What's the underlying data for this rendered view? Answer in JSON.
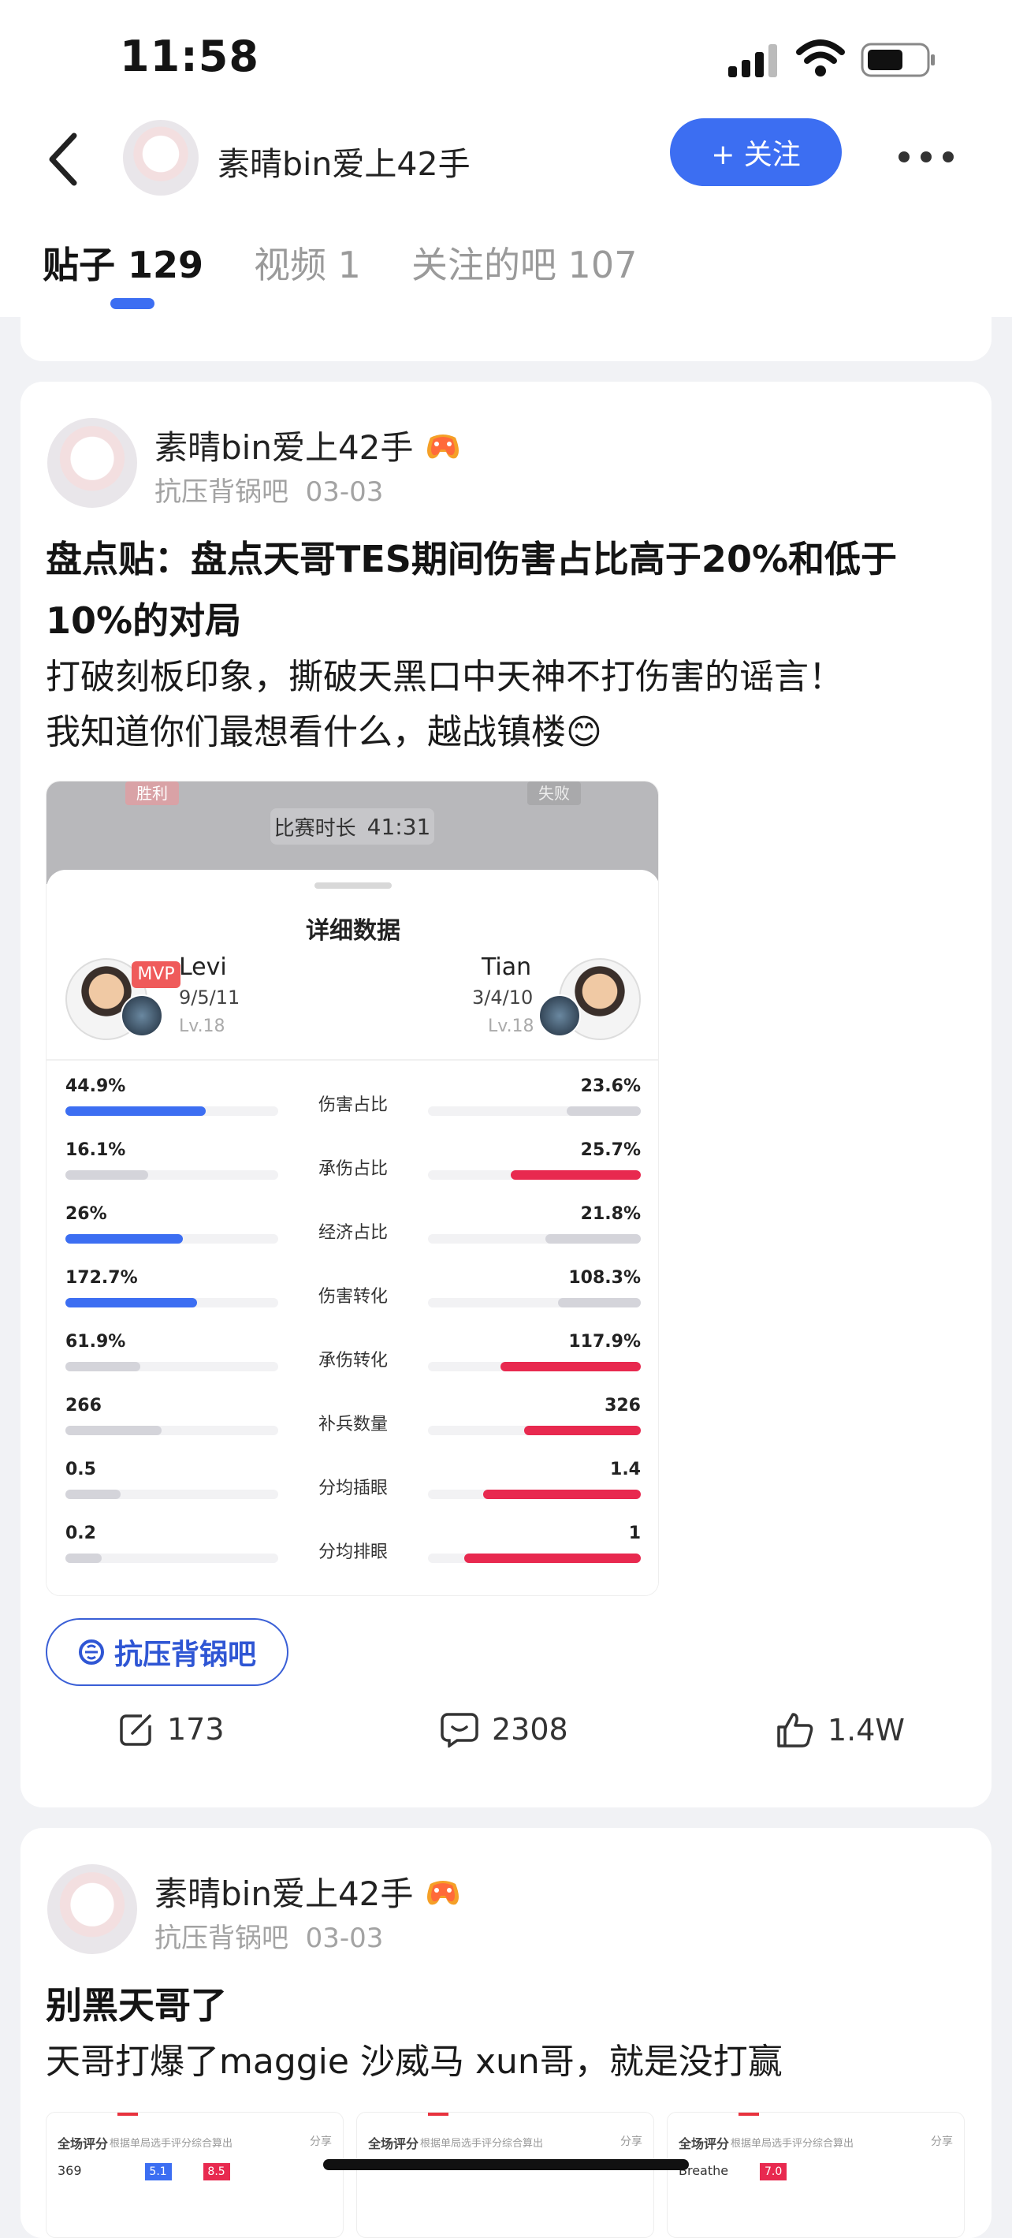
{
  "status_bar": {
    "time": "11:58"
  },
  "header": {
    "username": "素晴bin爱上42手",
    "follow_label": "+ 关注",
    "tabs": [
      {
        "label": "贴子 129"
      },
      {
        "label": "视频 1"
      },
      {
        "label": "关注的吧 107"
      }
    ]
  },
  "posts": [
    {
      "author": "素晴bin爱上42手",
      "forum": "抗压背锅吧",
      "date": "03-03",
      "title": "盘点贴：盘点天哥TES期间伤害占比高于20%和低于10%的对局",
      "body_lines": [
        "打破刻板印象，撕破天黑口中天神不打伤害的谣言！",
        "我知道你们最想看什么，越战镇楼😊"
      ],
      "forum_chip": "抗压背锅吧",
      "counts": {
        "share": "173",
        "comments": "2308",
        "likes": "1.4W"
      },
      "screenshot": {
        "win_label": "胜利",
        "lose_label": "失败",
        "duration_label": "比赛时长",
        "duration": "41:31",
        "sheet_title": "详细数据",
        "left_player": {
          "name": "Levi",
          "kda": "9/5/11",
          "level": "Lv.18",
          "mvp": "MVP"
        },
        "right_player": {
          "name": "Tian",
          "kda": "3/4/10",
          "level": "Lv.18"
        },
        "stats": [
          {
            "label": "伤害占比",
            "left": "44.9%",
            "right": "23.6%",
            "lfill": 0.66,
            "rfill": 0.35,
            "lcolor": "#3c6ef2",
            "rcolor": "#d4d4da"
          },
          {
            "label": "承伤占比",
            "left": "16.1%",
            "right": "25.7%",
            "lfill": 0.39,
            "rfill": 0.61,
            "lcolor": "#d4d4da",
            "rcolor": "#e8294f"
          },
          {
            "label": "经济占比",
            "left": "26%",
            "right": "21.8%",
            "lfill": 0.55,
            "rfill": 0.45,
            "lcolor": "#3c6ef2",
            "rcolor": "#d4d4da"
          },
          {
            "label": "伤害转化",
            "left": "172.7%",
            "right": "108.3%",
            "lfill": 0.62,
            "rfill": 0.39,
            "lcolor": "#3c6ef2",
            "rcolor": "#d4d4da"
          },
          {
            "label": "承伤转化",
            "left": "61.9%",
            "right": "117.9%",
            "lfill": 0.35,
            "rfill": 0.66,
            "lcolor": "#d4d4da",
            "rcolor": "#e8294f"
          },
          {
            "label": "补兵数量",
            "left": "266",
            "right": "326",
            "lfill": 0.45,
            "rfill": 0.55,
            "lcolor": "#d4d4da",
            "rcolor": "#e8294f"
          },
          {
            "label": "分均插眼",
            "left": "0.5",
            "right": "1.4",
            "lfill": 0.26,
            "rfill": 0.74,
            "lcolor": "#d4d4da",
            "rcolor": "#e8294f"
          },
          {
            "label": "分均排眼",
            "left": "0.2",
            "right": "1",
            "lfill": 0.17,
            "rfill": 0.83,
            "lcolor": "#d4d4da",
            "rcolor": "#e8294f"
          }
        ]
      }
    },
    {
      "author": "素晴bin爱上42手",
      "forum": "抗压背锅吧",
      "date": "03-03",
      "title": "别黑天哥了",
      "body": "天哥打爆了maggie 沙威马 xun哥，就是没打赢",
      "thumbs": [
        {
          "title": "全场评分",
          "sub": "根据单局选手评分综合算出",
          "share": "分享",
          "row_name": "369",
          "s1": "5.1",
          "s2": "8.5"
        },
        {
          "title": "全场评分",
          "sub": "根据单局选手评分综合算出",
          "share": "分享",
          "row_name": "",
          "s1": "",
          "s2": ""
        },
        {
          "title": "全场评分",
          "sub": "根据单局选手评分综合算出",
          "share": "分享",
          "row_name": "Breathe",
          "s1": "7.0",
          "s2": ""
        }
      ]
    }
  ]
}
